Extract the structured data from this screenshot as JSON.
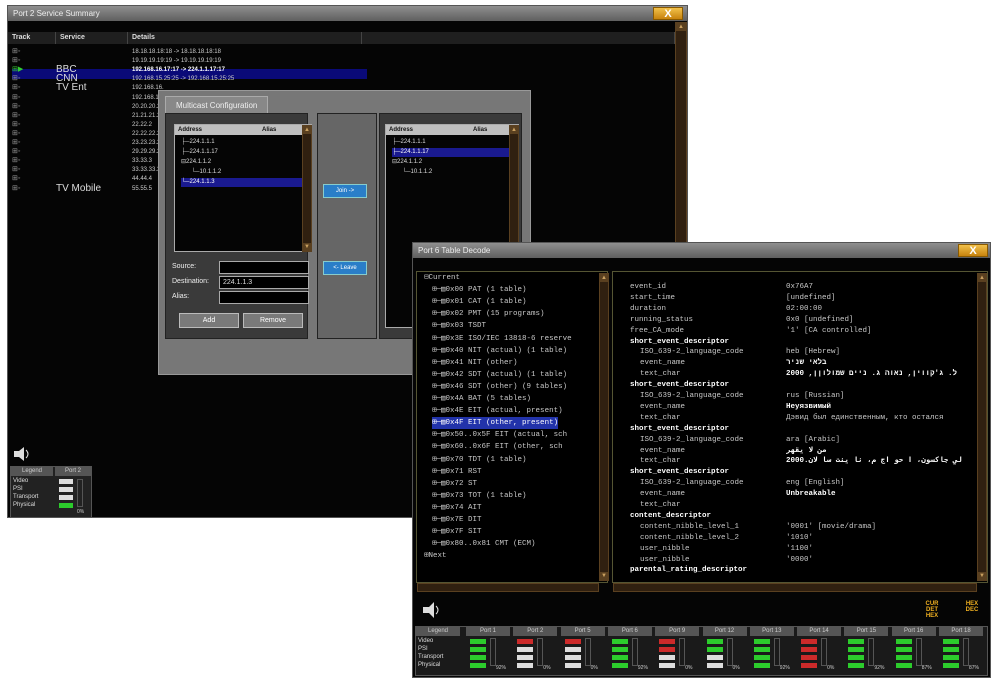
{
  "win1": {
    "title": "Port 2 Service Summary",
    "close": "X",
    "headers": [
      "Track",
      "Service",
      "Details"
    ],
    "services": [
      "BBC",
      "CNN",
      "TV Ent",
      "TV Mobile"
    ],
    "details": [
      "18.18.18.18:18 -> 18.18.18.18:18",
      "19.19.19.19:19 -> 19.19.19.19:19",
      "192.168.16.17:17 -> 224.1.1.17:17",
      "192.168.15.25:25 -> 192.168.15.25:25",
      "192.168.16.",
      "192.168.1",
      "20.20.20.2",
      "21.21.21.2",
      "22.22.2",
      "22.22.22.2",
      "23.23.23.2",
      "29.29.29.2",
      "33.33.3",
      "33.33.33.3",
      "44.44.4",
      "55.55.5"
    ],
    "legend": {
      "title": "Legend",
      "port": "Port 2",
      "rows": [
        "Video",
        "PSI",
        "Transport",
        "Physical"
      ],
      "pct": "0%"
    }
  },
  "multicast": {
    "tab": "Multicast Configuration",
    "left": {
      "h_address": "Address",
      "h_alias": "Alias",
      "items": [
        "224.1.1.1",
        "224.1.1.17",
        "224.1.1.2",
        "10.1.1.2",
        "224.1.1.3"
      ]
    },
    "right": {
      "h_address": "Address",
      "h_alias": "Alias",
      "items": [
        "224.1.1.1",
        "224.1.1.17",
        "224.1.1.2",
        "10.1.1.2"
      ]
    },
    "join": "Join ->",
    "leave": "<- Leave",
    "source_lbl": "Source:",
    "dest_lbl": "Destination:",
    "dest_val": "224.1.1.3",
    "alias_lbl": "Alias:",
    "add": "Add",
    "remove": "Remove"
  },
  "win2": {
    "title": "Port 6 Table Decode",
    "close": "X",
    "tree": [
      "Current",
      "0x00 PAT (1 table)",
      "0x01 CAT (1 table)",
      "0x02 PMT (15 programs)",
      "0x03 TSDT",
      "0x3E ISO/IEC 13818-6 reserve",
      "0x40 NIT (actual) (1 table)",
      "0x41 NIT (other)",
      "0x42 SDT (actual) (1 table)",
      "0x46 SDT (other) (9 tables)",
      "0x4A BAT (5 tables)",
      "0x4E EIT (actual, present)",
      "0x4F EIT (other, present)",
      "0x50..0x5F EIT (actual, sch",
      "0x60..0x6F EIT (other, sch",
      "0x70 TDT (1 table)",
      "0x71 RST",
      "0x72 ST",
      "0x73 TOT (1 table)",
      "0x74 AIT",
      "0x7E DIT",
      "0x7F SIT",
      "0x80..0x81 CMT (ECM)",
      "Next"
    ],
    "details": [
      {
        "k": "event_id",
        "v": "0x76A7",
        "i": 0
      },
      {
        "k": "start_time",
        "v": "[undefined]",
        "i": 0
      },
      {
        "k": "duration",
        "v": "02:00:00",
        "i": 0
      },
      {
        "k": "running_status",
        "v": "0x0 [undefined]",
        "i": 0
      },
      {
        "k": "free_CA_mode",
        "v": "'1' [CA controlled]",
        "i": 0
      },
      {
        "k": "short_event_descriptor",
        "v": "",
        "i": 0,
        "b": 1
      },
      {
        "k": "ISO_639-2_language_code",
        "v": "heb [Hebrew]",
        "i": 1
      },
      {
        "k": "event_name",
        "v": "בלאי שניר",
        "i": 1
      },
      {
        "k": "text_char",
        "v": "2000 ,ל. ג'קווין, נאוה ג. ניים שמולוןן",
        "i": 1
      },
      {
        "k": "short_event_descriptor",
        "v": "",
        "i": 0,
        "b": 1
      },
      {
        "k": "ISO_639-2_language_code",
        "v": "rus [Russian]",
        "i": 1
      },
      {
        "k": "event_name",
        "v": "Неуязвимый",
        "i": 1
      },
      {
        "k": "text_char",
        "v": "Дэвид был единственным, кто остался",
        "i": 1
      },
      {
        "k": "short_event_descriptor",
        "v": "",
        "i": 0,
        "b": 1
      },
      {
        "k": "ISO_639-2_language_code",
        "v": "ara [Arabic]",
        "i": 1
      },
      {
        "k": "event_name",
        "v": "من لا يقهر",
        "i": 1
      },
      {
        "k": "text_char",
        "v": "2000.لي جاكسون، ا حو اج م، نا ينت سا لان",
        "i": 1
      },
      {
        "k": "short_event_descriptor",
        "v": "",
        "i": 0,
        "b": 1
      },
      {
        "k": "ISO_639-2_language_code",
        "v": "eng [English]",
        "i": 1
      },
      {
        "k": "event_name",
        "v": "Unbreakable",
        "i": 1
      },
      {
        "k": "text_char",
        "v": "",
        "i": 1
      },
      {
        "k": "content_descriptor",
        "v": "",
        "i": 0,
        "b": 1
      },
      {
        "k": "content_nibble_level_1",
        "v": "'0001' [movie/drama]",
        "i": 1
      },
      {
        "k": "content_nibble_level_2",
        "v": "'1010'",
        "i": 1
      },
      {
        "k": "user_nibble",
        "v": "'1100'",
        "i": 1
      },
      {
        "k": "user_nibble",
        "v": "'0000'",
        "i": 1
      },
      {
        "k": "parental_rating_descriptor",
        "v": "",
        "i": 0,
        "b": 1
      }
    ],
    "curdet": "CUR DET HEX",
    "hexdec": "HEX DEC",
    "legend": {
      "title": "Legend",
      "rows": [
        "Video",
        "PSI",
        "Transport",
        "Physical"
      ],
      "ports": [
        {
          "name": "Port 1",
          "pct": "92%"
        },
        {
          "name": "Port 2",
          "pct": "0%"
        },
        {
          "name": "Port 5",
          "pct": "0%"
        },
        {
          "name": "Port 6",
          "pct": "92%"
        },
        {
          "name": "Port 9",
          "pct": "0%"
        },
        {
          "name": "Port 12",
          "pct": "0%"
        },
        {
          "name": "Port 13",
          "pct": "92%"
        },
        {
          "name": "Port 14",
          "pct": "0%"
        },
        {
          "name": "Port 15",
          "pct": "92%"
        },
        {
          "name": "Port 16",
          "pct": "87%"
        },
        {
          "name": "Port 18",
          "pct": "87%"
        }
      ]
    }
  }
}
